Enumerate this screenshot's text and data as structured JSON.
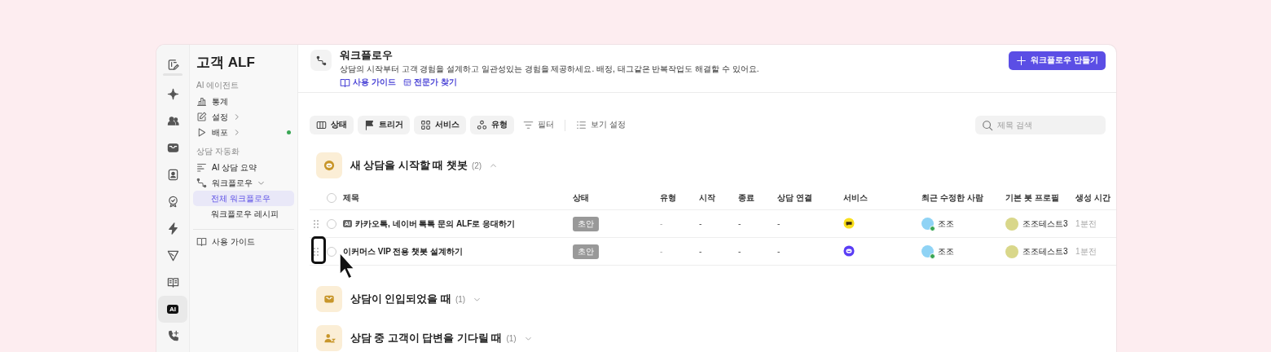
{
  "rail": [
    {
      "selected": false
    },
    {
      "selected": false
    },
    {
      "selected": false
    },
    {
      "selected": false
    },
    {
      "selected": false
    },
    {
      "selected": false
    },
    {
      "selected": false
    },
    {
      "selected": false
    },
    {
      "selected": false
    },
    {
      "selected": true,
      "badge": "AI"
    },
    {
      "selected": false
    }
  ],
  "sidebar": {
    "title": "고객 ALF",
    "sections": [
      {
        "heading": "AI 에이전트",
        "items": [
          {
            "label": "통계"
          },
          {
            "label": "설정",
            "expanded": false
          },
          {
            "label": "배포",
            "expanded": false,
            "status_dot": true
          }
        ]
      },
      {
        "heading": "상담 자동화",
        "items": [
          {
            "label": "AI 상담 요약"
          },
          {
            "label": "워크플로우",
            "expanded": true,
            "children": [
              {
                "label": "전체 워크플로우",
                "selected": true
              },
              {
                "label": "워크플로우 레시피",
                "selected": false
              }
            ]
          }
        ]
      }
    ],
    "footer_items": [
      {
        "label": "사용 가이드"
      }
    ]
  },
  "header": {
    "title": "워크플로우",
    "description": "상담의 시작부터 고객 경험을 설계하고 일관성있는 경험을 제공하세요. 배정, 태그같은 반복작업도 해결할 수 있어요.",
    "links": [
      "사용 가이드",
      "전문가 찾기"
    ],
    "create_button": "워크플로우 만들기"
  },
  "toolbar": {
    "chips": [
      "상태",
      "트리거",
      "서비스",
      "유형"
    ],
    "filter": "필터",
    "view_settings": "보기 설정",
    "search": {
      "placeholder": "제목 검색"
    }
  },
  "groups": [
    {
      "title": "새 상담을 시작할 때 챗봇",
      "count": "(2)",
      "expanded": true,
      "select_all_checked": false,
      "columns": [
        "제목",
        "상태",
        "유형",
        "시작",
        "종료",
        "상담 연결",
        "서비스",
        "최근 수정한 사람",
        "기본 봇 프로필",
        "생성 시간"
      ],
      "rows": [
        {
          "checked": false,
          "badge": "AI",
          "title": "카카오톡, 네이버 톡톡 문의 ALF로 응대하기",
          "status": "초안",
          "type": "-",
          "start": "-",
          "end": "-",
          "connection": "-",
          "service": {
            "kind": "bubble"
          },
          "modified_by": {
            "name": "조조",
            "online": true
          },
          "bot_profile": "조조테스트3",
          "created": "1분전"
        },
        {
          "checked": false,
          "title": "이커머스 VIP 전용 챗봇 설계하기",
          "status": "초안",
          "type": "-",
          "start": "-",
          "end": "-",
          "connection": "-",
          "service": {
            "kind": "bot"
          },
          "modified_by": {
            "name": "조조",
            "online": true
          },
          "bot_profile": "조조테스트3",
          "created": "1분전"
        }
      ]
    },
    {
      "title": "상담이 인입되었을 때",
      "count": "(1)",
      "expanded": false
    },
    {
      "title": "상담 중 고객이 답변을 기다릴 때",
      "count": "(1)",
      "expanded": false
    }
  ]
}
